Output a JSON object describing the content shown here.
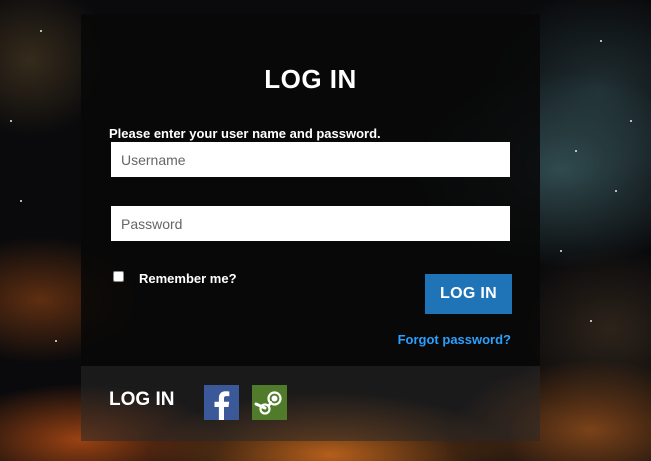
{
  "login": {
    "title": "LOG IN",
    "instructions": "Please enter your user name and password.",
    "username": {
      "placeholder": "Username",
      "value": ""
    },
    "password": {
      "placeholder": "Password",
      "value": ""
    },
    "remember_label": "Remember me?",
    "remember_checked": false,
    "submit_label": "LOG IN",
    "forgot_link": "Forgot password?"
  },
  "social_footer": {
    "title": "LOG IN",
    "providers": [
      {
        "icon": "facebook-icon",
        "color": "#3b5998"
      },
      {
        "icon": "steam-icon",
        "color": "#4f7b2a"
      }
    ]
  },
  "colors": {
    "accent": "#1f73b7",
    "link": "#2aa0ff"
  }
}
